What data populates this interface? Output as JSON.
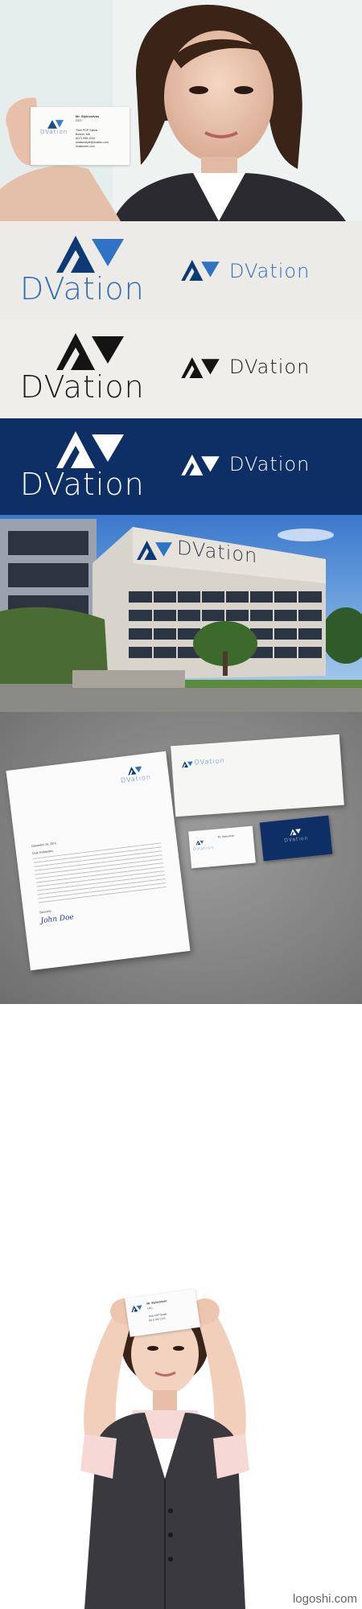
{
  "brand": {
    "name": "DVation",
    "colors": {
      "blue": "#1a4f8b",
      "navy": "#0d2f66",
      "black": "#141414",
      "white": "#ffffff",
      "paper": "#ededea",
      "mockup_bg": "#8a8a8a"
    }
  },
  "business_card": {
    "person_name": "Mr. Stylesstvan",
    "title": "CEO",
    "address_1": "Their POP Sands",
    "address_2": "Boston, MA",
    "phone": "(617) 555-1234",
    "email": "dvationstyle@dvation.com",
    "web": "dvationeer.com"
  },
  "letterhead": {
    "salutation": "Dear Sir/Madam,",
    "date": "November 26, 2014",
    "closing": "Sincerely,",
    "signer": "John Doe"
  },
  "watermark": "logoshi.com"
}
